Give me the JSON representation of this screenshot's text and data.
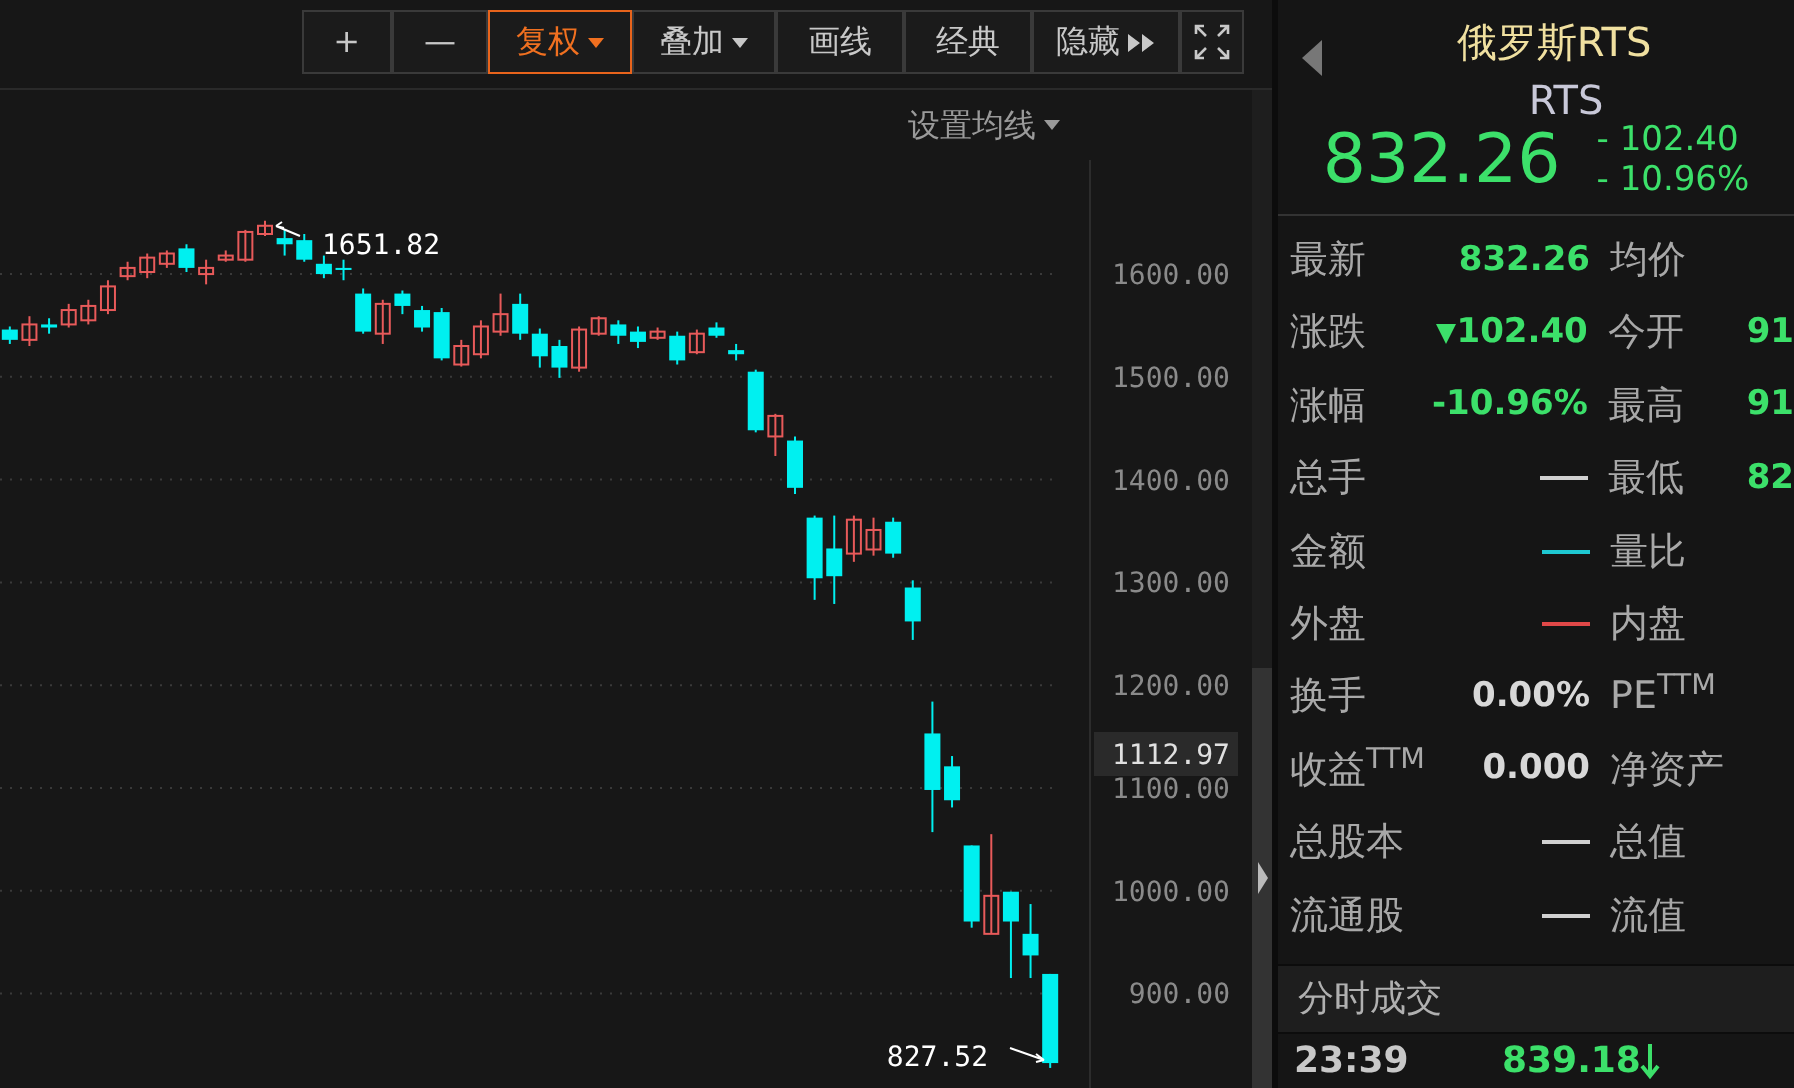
{
  "toolbar": {
    "buttons": [
      {
        "label": "+",
        "kind": "plain",
        "selected": false
      },
      {
        "label": "—",
        "kind": "plain",
        "selected": false
      },
      {
        "label": "复权",
        "kind": "dropdown",
        "selected": true
      },
      {
        "label": "叠加",
        "kind": "dropdown",
        "selected": false
      },
      {
        "label": "画线",
        "kind": "plain",
        "selected": false
      },
      {
        "label": "经典",
        "kind": "plain",
        "selected": false
      },
      {
        "label": "隐藏",
        "kind": "expand",
        "selected": false
      },
      {
        "kind": "fullscreen",
        "selected": false
      }
    ]
  },
  "chart": {
    "ma_setting": "设置均线",
    "current_price": "1112.97",
    "high_marker": "1651.82",
    "low_marker": "827.52",
    "chart_data": {
      "type": "candlestick",
      "grid": true,
      "ylim": [
        808,
        1711
      ],
      "categories": [
        null,
        null,
        null,
        null,
        null,
        null,
        null,
        null,
        null,
        null,
        null,
        null,
        null,
        null,
        null,
        null,
        null,
        null,
        null,
        null,
        null,
        null,
        null,
        null,
        null,
        null,
        null,
        null,
        null,
        null,
        null,
        null,
        null,
        null,
        null,
        null,
        null,
        null,
        null,
        null,
        null,
        null,
        null,
        null,
        null,
        null,
        null,
        null,
        null,
        null,
        null,
        null,
        null,
        null
      ],
      "yticks": [
        {
          "value": 1600,
          "label": "1600.00"
        },
        {
          "value": 1500,
          "label": "1500.00"
        },
        {
          "value": 1400,
          "label": "1400.00"
        },
        {
          "value": 1300,
          "label": "1300.00"
        },
        {
          "value": 1200,
          "label": "1200.00"
        },
        {
          "value": 1100,
          "label": "1100.00"
        },
        {
          "value": 1000,
          "label": "1000.00"
        },
        {
          "value": 900,
          "label": "900.00"
        }
      ],
      "series": [
        {
          "ohlc": [
            [
              1546,
              1549,
              1532,
              1536
            ],
            [
              1536,
              1559,
              1530,
              1551
            ],
            [
              1551,
              1557,
              1542,
              1548
            ],
            [
              1551,
              1571,
              1548,
              1565
            ],
            [
              1555,
              1575,
              1551,
              1569
            ],
            [
              1565,
              1594,
              1561,
              1588
            ],
            [
              1598,
              1612,
              1594,
              1606
            ],
            [
              1602,
              1620,
              1596,
              1616
            ],
            [
              1610,
              1623,
              1606,
              1620
            ],
            [
              1625,
              1629,
              1602,
              1606
            ],
            [
              1600,
              1614,
              1590,
              1606
            ],
            [
              1614,
              1623,
              1612,
              1618
            ],
            [
              1614,
              1643,
              1612,
              1641
            ],
            [
              1639,
              1651.82,
              1637,
              1647
            ],
            [
              1635,
              1643,
              1618,
              1629
            ],
            [
              1633,
              1639,
              1612,
              1614
            ],
            [
              1610,
              1618,
              1596,
              1600
            ],
            [
              1606,
              1614,
              1594,
              1604
            ],
            [
              1581,
              1586,
              1542,
              1544
            ],
            [
              1542,
              1575,
              1532,
              1571
            ],
            [
              1581,
              1584,
              1561,
              1569
            ],
            [
              1565,
              1569,
              1544,
              1548
            ],
            [
              1563,
              1567,
              1516,
              1518
            ],
            [
              1512,
              1536,
              1510,
              1530
            ],
            [
              1522,
              1555,
              1518,
              1549
            ],
            [
              1544,
              1581,
              1540,
              1561
            ],
            [
              1571,
              1581,
              1536,
              1542
            ],
            [
              1542,
              1547,
              1509,
              1520
            ],
            [
              1530,
              1536,
              1499,
              1509
            ],
            [
              1509,
              1549,
              1505,
              1546
            ],
            [
              1542,
              1559,
              1540,
              1557
            ],
            [
              1551,
              1555,
              1532,
              1540
            ],
            [
              1544,
              1549,
              1528,
              1534
            ],
            [
              1538,
              1548,
              1536,
              1544
            ],
            [
              1540,
              1544,
              1512,
              1516
            ],
            [
              1524,
              1546,
              1522,
              1542
            ],
            [
              1548,
              1553,
              1538,
              1540
            ],
            [
              1526,
              1532,
              1516,
              1522
            ],
            [
              1505,
              1507,
              1446,
              1448
            ],
            [
              1442,
              1464,
              1423,
              1462
            ],
            [
              1438,
              1442,
              1386,
              1392
            ],
            [
              1363,
              1365,
              1283,
              1304
            ],
            [
              1333,
              1365,
              1279,
              1306
            ],
            [
              1328,
              1365,
              1320,
              1361
            ],
            [
              1332,
              1363,
              1326,
              1351
            ],
            [
              1359,
              1363,
              1324,
              1328
            ],
            [
              1295,
              1302,
              1244,
              1262
            ],
            [
              1153,
              1184,
              1057,
              1098
            ],
            [
              1121,
              1131,
              1081,
              1088
            ],
            [
              1044,
              1044,
              964,
              970
            ],
            [
              958,
              1055,
              958,
              995
            ],
            [
              999,
              999,
              915,
              970
            ],
            [
              958,
              987,
              915,
              937
            ],
            [
              919,
              919,
              827.52,
              832.26
            ]
          ]
        }
      ]
    }
  },
  "quote": {
    "name": "俄罗斯RTS",
    "code": "RTS",
    "price": "832.26",
    "change": "- 102.40",
    "change_pct": "- 10.96%",
    "color": "#3ce06a",
    "rows": [
      {
        "label": "最新",
        "kind": "text",
        "value": "832.26",
        "color": "#3ce06a",
        "label2": "均价"
      },
      {
        "label": "涨跌",
        "kind": "change",
        "value": "102.40",
        "color": "#3ce06a",
        "label2": "今开",
        "value2": "91"
      },
      {
        "label": "涨幅",
        "kind": "text",
        "value": "-10.96%",
        "color": "#3ce06a",
        "label2": "最高",
        "value2": "91"
      },
      {
        "label": "总手",
        "kind": "dash",
        "color": "#d0d0d0",
        "label2": "最低",
        "value2": "82"
      },
      {
        "label": "金额",
        "kind": "dash",
        "color": "#1ec8d2",
        "label2": "量比"
      },
      {
        "label": "外盘",
        "kind": "dash",
        "color": "#e04848",
        "label2": "内盘"
      },
      {
        "label": "换手",
        "kind": "text",
        "value": "0.00%",
        "color": "#d8d8d8",
        "label2": "PE$^{TTM}$"
      },
      {
        "label": "收益$^{TTM}$",
        "kind": "text",
        "value": "0.000",
        "color": "#d8d8d8",
        "label2": "净资产"
      },
      {
        "label": "总股本",
        "kind": "dash",
        "color": "#d0d0d0",
        "label2": "总值"
      },
      {
        "label": "流通股",
        "kind": "dash",
        "color": "#d0d0d0",
        "label2": "流值"
      }
    ]
  },
  "ticks": {
    "title": "分时成交",
    "rows": [
      {
        "time": "23:39",
        "price": "839.18",
        "color": "#3ce06a",
        "kind": "fall"
      }
    ]
  }
}
